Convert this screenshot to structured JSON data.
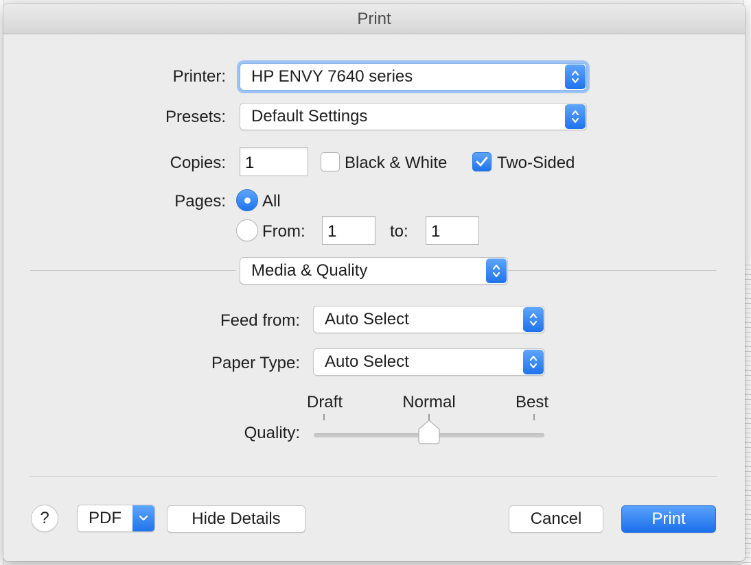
{
  "window": {
    "title": "Print"
  },
  "printer": {
    "label": "Printer:",
    "value": "HP ENVY 7640 series"
  },
  "presets": {
    "label": "Presets:",
    "value": "Default Settings"
  },
  "copies": {
    "label": "Copies:",
    "value": "1",
    "black_white": {
      "label": "Black & White",
      "checked": false
    },
    "two_sided": {
      "label": "Two-Sided",
      "checked": true
    }
  },
  "pages": {
    "label": "Pages:",
    "all_label": "All",
    "from_label": "From:",
    "to_label": "to:",
    "from_value": "1",
    "to_value": "1",
    "selected": "all"
  },
  "section": {
    "value": "Media & Quality"
  },
  "feed_from": {
    "label": "Feed from:",
    "value": "Auto Select"
  },
  "paper_type": {
    "label": "Paper Type:",
    "value": "Auto Select"
  },
  "quality": {
    "label": "Quality:",
    "stops": [
      "Draft",
      "Normal",
      "Best"
    ],
    "selected": "Normal",
    "level": 0.5
  },
  "footer": {
    "help": "?",
    "pdf": "PDF",
    "hide_details": "Hide Details",
    "cancel": "Cancel",
    "print": "Print"
  },
  "colors": {
    "accent": "#1f73ec",
    "sheet_bg": "#ececec"
  }
}
